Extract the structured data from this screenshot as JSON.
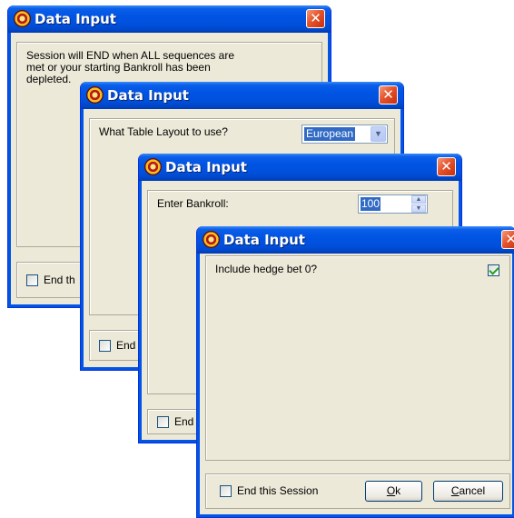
{
  "colors": {
    "titlebar": "#0054e3",
    "close": "#e5532c",
    "face": "#ece9d8",
    "check": "#21a121"
  },
  "dialogs": [
    {
      "title": "Data Input",
      "prompt_lines": [
        "Session will END when ALL sequences are",
        "met or your starting Bankroll has been",
        "depleted."
      ],
      "end_session_label": "End th"
    },
    {
      "title": "Data Input",
      "prompt": "What Table Layout to use?",
      "select_value": "European",
      "end_session_label": "End"
    },
    {
      "title": "Data Input",
      "prompt": "Enter Bankroll:",
      "bankroll_value": "100",
      "end_session_label": "End"
    },
    {
      "title": "Data Input",
      "prompt": "Include hedge bet 0?",
      "end_session_label": "End this Session",
      "ok_mnemonic": "O",
      "ok_rest": "k",
      "cancel_mnemonic": "C",
      "cancel_rest": "ancel"
    }
  ],
  "icons": {
    "app": "roulette-wheel-icon",
    "close": "close-icon",
    "dropdown": "chevron-down-icon",
    "spin_up": "spin-up-icon",
    "spin_down": "spin-down-icon"
  }
}
